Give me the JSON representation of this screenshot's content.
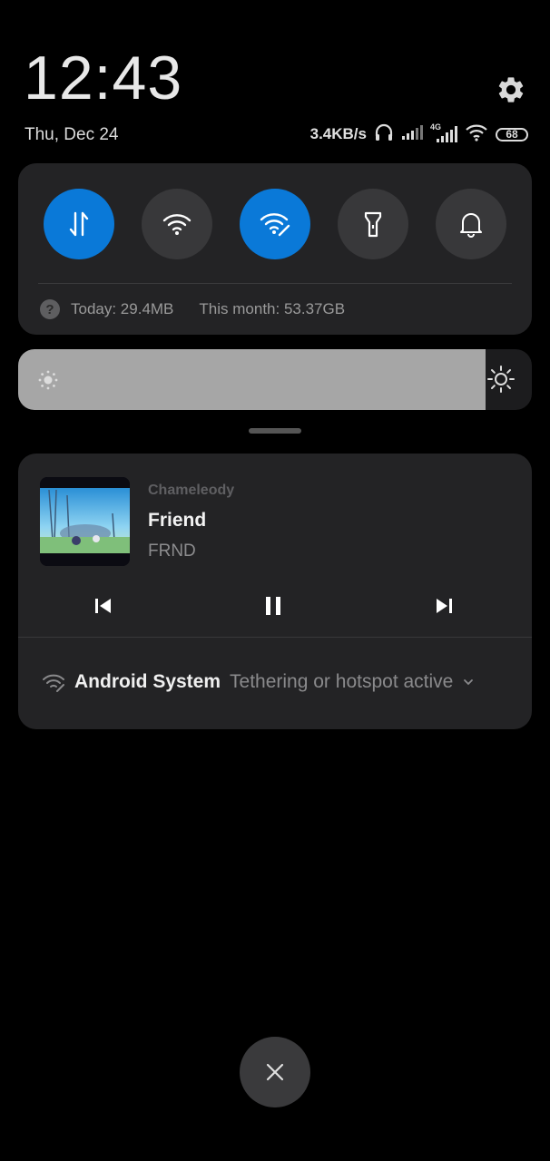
{
  "header": {
    "time": "12:43",
    "date": "Thu, Dec 24"
  },
  "status_bar": {
    "net_speed": "3.4KB/s",
    "network_type": "4G",
    "battery_level": "68",
    "icons": [
      "headphones-icon",
      "signal-icon",
      "signal-4g-icon",
      "wifi-icon",
      "battery-icon"
    ]
  },
  "quick_settings": {
    "toggles": [
      {
        "name": "mobile-data",
        "icon": "data-transfer-icon",
        "active": true
      },
      {
        "name": "wifi",
        "icon": "wifi-icon",
        "active": false
      },
      {
        "name": "hotspot",
        "icon": "hotspot-icon",
        "active": true
      },
      {
        "name": "flashlight",
        "icon": "flashlight-icon",
        "active": false
      },
      {
        "name": "notification-bell",
        "icon": "bell-icon",
        "active": false
      }
    ],
    "data_usage_today": "Today: 29.4MB",
    "data_usage_month": "This month: 53.37GB",
    "accent_color": "#0a79d8"
  },
  "brightness": {
    "level": 0.91
  },
  "media": {
    "artist": "Chameleody",
    "title": "Friend",
    "album": "FRND"
  },
  "system_notification": {
    "app": "Android System",
    "text": "Tethering or hotspot active"
  }
}
